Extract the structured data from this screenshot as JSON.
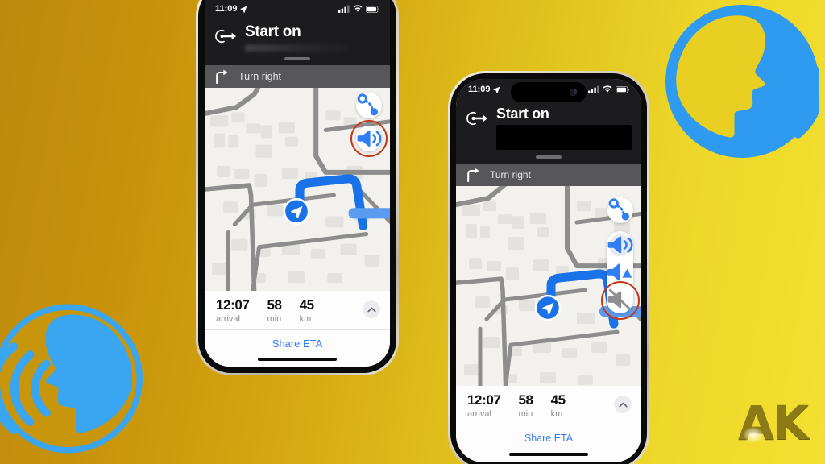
{
  "theme": {
    "bg_gradient_from": "#bd8a0c",
    "bg_gradient_to": "#f3e031",
    "accent_blue": "#2f7ef3",
    "route_blue": "#1a72e8",
    "highlight_ring": "#c0391a",
    "banner_bg": "#1c1c1e",
    "nextstep_bg": "#57575a",
    "watermark_color": "#8c7a17"
  },
  "watermark": {
    "text": "AK"
  },
  "badges": [
    {
      "name": "speaking-head-badge-top-right",
      "circle_color": "#2e9bf0",
      "figure_color": "#e8cf22",
      "facing": "right"
    },
    {
      "name": "speaking-head-badge-bottom-left",
      "circle_color": "#c8960d",
      "figure_color": "#3aa5f0",
      "facing": "left"
    }
  ],
  "phones": [
    {
      "id": "phone-left",
      "model_style": "notch",
      "status_bar": {
        "time": "11:09",
        "location_arrow": "location-arrow-icon",
        "signal": "cellular-signal-icon",
        "wifi": "wifi-icon",
        "battery": "battery-icon"
      },
      "banner": {
        "maneuver_icon": "start-on-route-icon",
        "title": "Start on",
        "street_name": "",
        "street_redacted": false
      },
      "next_step": {
        "icon": "turn-right-icon",
        "label": "Turn right"
      },
      "map": {
        "controls": [
          {
            "name": "route-overview-button",
            "icon": "route-overview-icon",
            "highlighted": false
          },
          {
            "name": "audio-button",
            "icon": "speaker-on-icon",
            "highlighted": true
          }
        ],
        "audio_menu_open": false
      },
      "eta": {
        "arrival_value": "12:07",
        "arrival_label": "arrival",
        "duration_value": "58",
        "duration_label": "min",
        "distance_value": "45",
        "distance_label": "km",
        "expand_icon": "chevron-up-icon",
        "share_label": "Share ETA"
      }
    },
    {
      "id": "phone-right",
      "model_style": "dynamic-island",
      "status_bar": {
        "time": "11:09",
        "location_arrow": "location-arrow-icon",
        "signal": "cellular-signal-icon",
        "wifi": "wifi-icon",
        "battery": "battery-icon"
      },
      "banner": {
        "maneuver_icon": "start-on-route-icon",
        "title": "Start on",
        "street_name": "",
        "street_redacted": true
      },
      "next_step": {
        "icon": "turn-right-icon",
        "label": "Turn right"
      },
      "map": {
        "controls": [
          {
            "name": "route-overview-button",
            "icon": "route-overview-icon",
            "highlighted": false
          }
        ],
        "audio_menu_open": true,
        "audio_options": [
          {
            "name": "audio-option-full-volume",
            "icon": "speaker-on-icon",
            "selected": true
          },
          {
            "name": "audio-option-alerts-only",
            "icon": "speaker-alerts-icon",
            "selected": false
          },
          {
            "name": "audio-option-muted",
            "icon": "speaker-muted-icon",
            "selected": false,
            "highlighted": true
          }
        ]
      },
      "eta": {
        "arrival_value": "12:07",
        "arrival_label": "arrival",
        "duration_value": "58",
        "duration_label": "min",
        "distance_value": "45",
        "distance_label": "km",
        "expand_icon": "chevron-up-icon",
        "share_label": "Share ETA"
      }
    }
  ]
}
